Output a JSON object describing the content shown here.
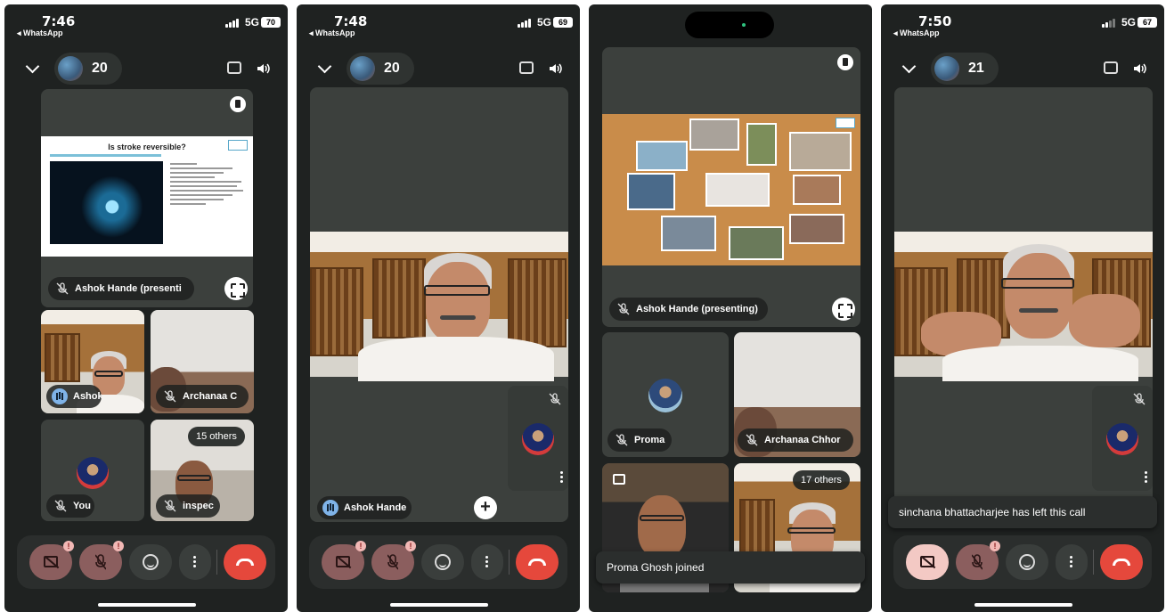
{
  "screens": [
    {
      "status": {
        "time": "7:46",
        "back_app": "◂ WhatsApp",
        "network": "5G",
        "battery": "70"
      },
      "participant_count": "20",
      "presenter_label": "Ashok Hande (presenti",
      "slide_title": "Is stroke reversible?",
      "tiles": [
        {
          "label": "Ashok"
        },
        {
          "label": "Archanaa C"
        },
        {
          "label": "You"
        },
        {
          "label": "inspec",
          "others": "15 others"
        }
      ]
    },
    {
      "status": {
        "time": "7:48",
        "back_app": "◂ WhatsApp",
        "network": "5G",
        "battery": "69"
      },
      "participant_count": "20",
      "speaker_label": "Ashok Hande"
    },
    {
      "presenter_label": "Ashok Hande (presenting)",
      "tiles": [
        {
          "label": "Proma"
        },
        {
          "label": "Archanaa Chhor"
        },
        {
          "label": "",
          "others": "17 others"
        }
      ],
      "toast": "Proma Ghosh joined"
    },
    {
      "status": {
        "time": "7:50",
        "back_app": "◂ WhatsApp",
        "network": "5G",
        "battery": "67"
      },
      "participant_count": "21",
      "toast": "sinchana bhattacharjee has left this call"
    }
  ],
  "colors": {
    "background": "#1f2221",
    "tile": "#3c403d",
    "end_call": "#e5483c",
    "muted": "#8b5e5e"
  }
}
